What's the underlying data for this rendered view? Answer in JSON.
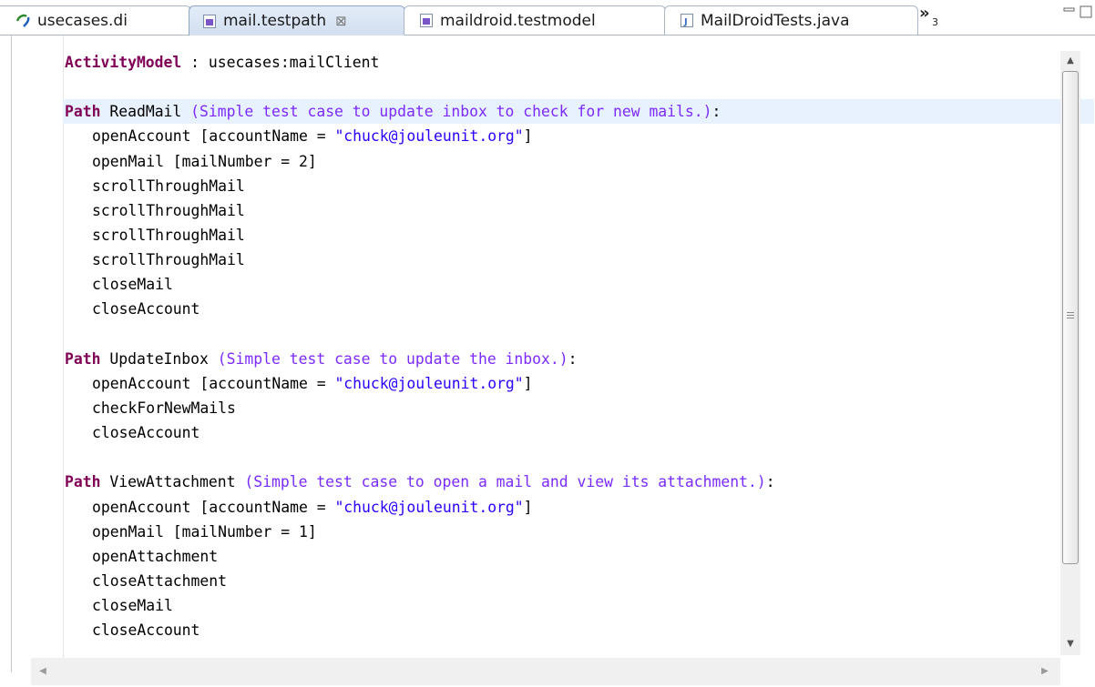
{
  "tabs": [
    {
      "label": "usecases.di",
      "icon": "diagram-icon",
      "active": false
    },
    {
      "label": "mail.testpath",
      "icon": "file-icon",
      "active": true,
      "close": "⊠"
    },
    {
      "label": "maildroid.testmodel",
      "icon": "file-icon",
      "active": false
    },
    {
      "label": "MailDroidTests.java",
      "icon": "java-file-icon",
      "active": false
    }
  ],
  "overflow": {
    "symbol": "»",
    "count": "3"
  },
  "editor": {
    "lines": [
      {
        "kw": "ActivityModel",
        "rest": " : usecases:mailClient"
      },
      {
        "blank": true
      },
      {
        "kw": "Path",
        "name": " ReadMail ",
        "comment": "(Simple test case to update inbox to check for new mails.)",
        "tail": ":"
      },
      {
        "indent": true,
        "code": "openAccount [accountName = ",
        "str": "\"chuck@jouleunit.org\"",
        "tail": "]"
      },
      {
        "indent": true,
        "code": "openMail [mailNumber = 2]"
      },
      {
        "indent": true,
        "code": "scrollThroughMail"
      },
      {
        "indent": true,
        "code": "scrollThroughMail"
      },
      {
        "indent": true,
        "code": "scrollThroughMail"
      },
      {
        "indent": true,
        "code": "scrollThroughMail"
      },
      {
        "indent": true,
        "code": "closeMail"
      },
      {
        "indent": true,
        "code": "closeAccount"
      },
      {
        "blank": true
      },
      {
        "kw": "Path",
        "name": " UpdateInbox ",
        "comment": "(Simple test case to update the inbox.)",
        "tail": ":"
      },
      {
        "indent": true,
        "code": "openAccount [accountName = ",
        "str": "\"chuck@jouleunit.org\"",
        "tail": "]"
      },
      {
        "indent": true,
        "code": "checkForNewMails"
      },
      {
        "indent": true,
        "code": "closeAccount"
      },
      {
        "blank": true
      },
      {
        "kw": "Path",
        "name": " ViewAttachment ",
        "comment": "(Simple test case to open a mail and view its attachment.)",
        "tail": ":"
      },
      {
        "indent": true,
        "code": "openAccount [accountName = ",
        "str": "\"chuck@jouleunit.org\"",
        "tail": "]"
      },
      {
        "indent": true,
        "code": "openMail [mailNumber = 1]"
      },
      {
        "indent": true,
        "code": "openAttachment"
      },
      {
        "indent": true,
        "code": "closeAttachment"
      },
      {
        "indent": true,
        "code": "closeMail"
      },
      {
        "indent": true,
        "code": "closeAccount"
      }
    ]
  },
  "colors": {
    "keyword": "#7f0055",
    "string": "#2a00ff",
    "comment": "#7b2bff",
    "highlight": "#e8f2fe"
  }
}
